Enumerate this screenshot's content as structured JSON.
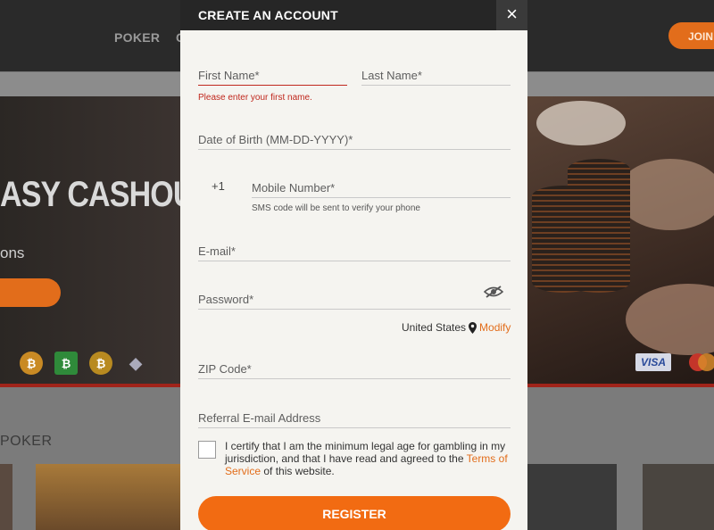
{
  "background": {
    "nav": {
      "poker": "POKER",
      "partial": "C"
    },
    "join_label": "JOIN",
    "hero": {
      "headline": "ASY CASHOUT",
      "subline": "ons"
    },
    "payment": {
      "visa": "VISA"
    },
    "section_title": "POKER"
  },
  "modal": {
    "title": "CREATE AN ACCOUNT",
    "close_glyph": "×",
    "first_name": {
      "placeholder": "First Name*",
      "value": "",
      "error": "Please enter your first name."
    },
    "last_name": {
      "placeholder": "Last Name*",
      "value": ""
    },
    "dob": {
      "placeholder": "Date of Birth (MM-DD-YYYY)*",
      "value": ""
    },
    "mobile": {
      "prefix": "+1",
      "placeholder": "Mobile Number*",
      "value": "",
      "hint": "SMS code will be sent to verify your phone"
    },
    "email": {
      "placeholder": "E-mail*",
      "value": ""
    },
    "password": {
      "placeholder": "Password*",
      "value": ""
    },
    "country": {
      "name": "United States",
      "modify_label": "Modify"
    },
    "zip": {
      "placeholder": "ZIP Code*",
      "value": ""
    },
    "referral": {
      "placeholder": "Referral E-mail Address",
      "value": ""
    },
    "certify": {
      "text_before": "I certify that I am the minimum legal age for gambling in my jurisdiction, and that I have read and agreed to the ",
      "tos_link": "Terms of Service",
      "text_after": " of this website.",
      "checked": false
    },
    "register_label": "REGISTER"
  },
  "colors": {
    "accent": "#f26b12",
    "error": "#c0271d",
    "header": "#262626"
  },
  "icons": [
    "close-icon",
    "eye-slash-icon",
    "map-pin-icon",
    "bitcoin-icon",
    "bitcoin-cash-icon",
    "bitcoin-sv-icon",
    "ethereum-icon",
    "visa-icon",
    "mastercard-icon"
  ]
}
